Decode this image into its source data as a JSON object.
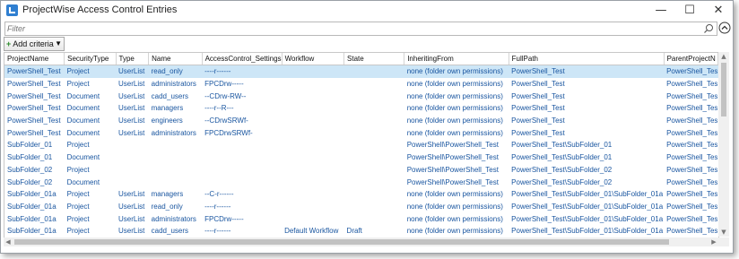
{
  "window": {
    "title": "ProjectWise Access Control Entries"
  },
  "filter": {
    "placeholder": "Filter"
  },
  "toolbar": {
    "add_criteria_label": "Add criteria"
  },
  "table": {
    "columns": [
      "ProjectName",
      "SecurityType",
      "Type",
      "Name",
      "AccessControl_Settings",
      "Workflow",
      "State",
      "InheritingFrom",
      "FullPath",
      "ParentProjectN"
    ],
    "rows": [
      [
        "PowerShell_Test",
        "Project",
        "UserList",
        "read_only",
        "----r------",
        "",
        "",
        "none (folder own permissions)",
        "PowerShell_Test",
        "PowerShell_Tes"
      ],
      [
        "PowerShell_Test",
        "Project",
        "UserList",
        "administrators",
        "FPCDrw-----",
        "",
        "",
        "none (folder own permissions)",
        "PowerShell_Test",
        "PowerShell_Tes"
      ],
      [
        "PowerShell_Test",
        "Document",
        "UserList",
        "cadd_users",
        "--CDrw-RW--",
        "",
        "",
        "none (folder own permissions)",
        "PowerShell_Test",
        "PowerShell_Tes"
      ],
      [
        "PowerShell_Test",
        "Document",
        "UserList",
        "managers",
        "----r--R---",
        "",
        "",
        "none (folder own permissions)",
        "PowerShell_Test",
        "PowerShell_Tes"
      ],
      [
        "PowerShell_Test",
        "Document",
        "UserList",
        "engineers",
        "--CDrwSRWf-",
        "",
        "",
        "none (folder own permissions)",
        "PowerShell_Test",
        "PowerShell_Tes"
      ],
      [
        "PowerShell_Test",
        "Document",
        "UserList",
        "administrators",
        "FPCDrwSRWf-",
        "",
        "",
        "none (folder own permissions)",
        "PowerShell_Test",
        "PowerShell_Tes"
      ],
      [
        "SubFolder_01",
        "Project",
        "",
        "",
        "",
        "",
        "",
        "PowerShell\\PowerShell_Test",
        "PowerShell_Test\\SubFolder_01",
        "PowerShell_Tes"
      ],
      [
        "SubFolder_01",
        "Document",
        "",
        "",
        "",
        "",
        "",
        "PowerShell\\PowerShell_Test",
        "PowerShell_Test\\SubFolder_01",
        "PowerShell_Tes"
      ],
      [
        "SubFolder_02",
        "Project",
        "",
        "",
        "",
        "",
        "",
        "PowerShell\\PowerShell_Test",
        "PowerShell_Test\\SubFolder_02",
        "PowerShell_Tes"
      ],
      [
        "SubFolder_02",
        "Document",
        "",
        "",
        "",
        "",
        "",
        "PowerShell\\PowerShell_Test",
        "PowerShell_Test\\SubFolder_02",
        "PowerShell_Tes"
      ],
      [
        "SubFolder_01a",
        "Project",
        "UserList",
        "managers",
        "--C-r------",
        "",
        "",
        "none (folder own permissions)",
        "PowerShell_Test\\SubFolder_01\\SubFolder_01a",
        "PowerShell_Tes"
      ],
      [
        "SubFolder_01a",
        "Project",
        "UserList",
        "read_only",
        "----r------",
        "",
        "",
        "none (folder own permissions)",
        "PowerShell_Test\\SubFolder_01\\SubFolder_01a",
        "PowerShell_Tes"
      ],
      [
        "SubFolder_01a",
        "Project",
        "UserList",
        "administrators",
        "FPCDrw-----",
        "",
        "",
        "none (folder own permissions)",
        "PowerShell_Test\\SubFolder_01\\SubFolder_01a",
        "PowerShell_Tes"
      ],
      [
        "SubFolder_01a",
        "Project",
        "UserList",
        "cadd_users",
        "----r------",
        "Default Workflow",
        "Draft",
        "none (folder own permissions)",
        "PowerShell_Test\\SubFolder_01\\SubFolder_01a",
        "PowerShell_Tes"
      ]
    ],
    "selected_row": 0
  },
  "colors": {
    "accent": "#2f7fd1",
    "selection": "#cde6f7",
    "cell_text": "#1a56a0"
  }
}
